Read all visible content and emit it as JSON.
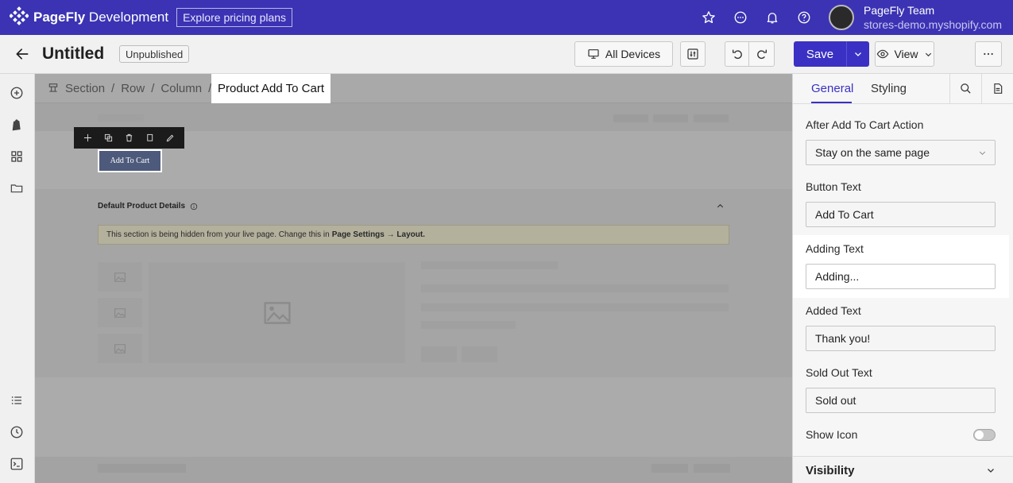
{
  "topbar": {
    "brand": "PageFly",
    "brand_suffix": " Development",
    "pricing_label": "Explore pricing plans",
    "user_name": "PageFly Team",
    "store": "stores-demo.myshopify.com",
    "icons": [
      "star-icon",
      "chat-icon",
      "bell-icon",
      "help-icon"
    ]
  },
  "header": {
    "title": "Untitled",
    "status": "Unpublished",
    "devices_label": "All Devices",
    "save_label": "Save",
    "view_label": "View"
  },
  "breadcrumb": {
    "items": [
      "Section",
      "Row",
      "Column"
    ],
    "separator": "/",
    "current": "Product Add To Cart"
  },
  "canvas": {
    "button_text": "Add To Cart",
    "section_title": "Default Product Details",
    "notice_text": "This section is being hidden from your live page. Change this in",
    "notice_bold": "Page Settings → Layout."
  },
  "panel": {
    "tabs": [
      "General",
      "Styling"
    ],
    "active_tab": "General",
    "after_action_label": "After Add To Cart Action",
    "after_action_value": "Stay on the same page",
    "button_text_label": "Button Text",
    "button_text_value": "Add To Cart",
    "adding_text_label": "Adding Text",
    "adding_text_value": "Adding...",
    "added_text_label": "Added Text",
    "added_text_value": "Thank you!",
    "sold_out_label": "Sold Out Text",
    "sold_out_value": "Sold out",
    "show_icon_label": "Show Icon",
    "show_icon_on": false,
    "visibility_label": "Visibility"
  },
  "colors": {
    "topbar": "#3b33b3",
    "accent": "#3a31c4",
    "tab_active": "#3a31c4"
  }
}
